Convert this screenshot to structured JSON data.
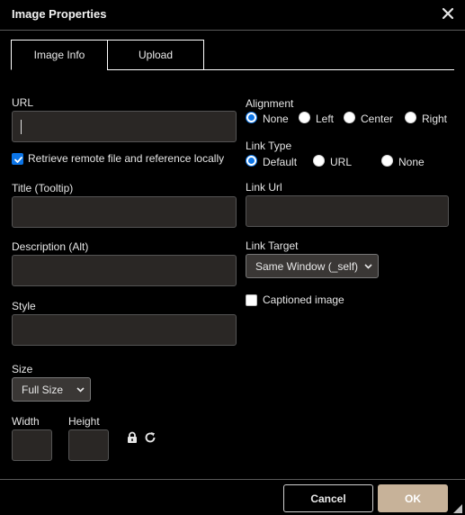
{
  "dialog": {
    "title": "Image Properties"
  },
  "tabs": [
    {
      "label": "Image Info",
      "active": true
    },
    {
      "label": "Upload",
      "active": false
    }
  ],
  "fields": {
    "url_label": "URL",
    "url_value": "",
    "retrieve_label": "Retrieve remote file and reference locally",
    "retrieve_checked": true,
    "title_label": "Title (Tooltip)",
    "title_value": "",
    "description_label": "Description (Alt)",
    "description_value": "",
    "style_label": "Style",
    "style_value": "",
    "size_label": "Size",
    "size_selected": "Full Size",
    "width_label": "Width",
    "width_value": "",
    "height_label": "Height",
    "height_value": ""
  },
  "alignment": {
    "label": "Alignment",
    "options": [
      "None",
      "Left",
      "Center",
      "Right"
    ],
    "selected": "None"
  },
  "link_type": {
    "label": "Link Type",
    "options": [
      "Default",
      "URL",
      "None"
    ],
    "selected": "Default"
  },
  "link_url": {
    "label": "Link Url",
    "value": ""
  },
  "link_target": {
    "label": "Link Target",
    "selected": "Same Window (_self)"
  },
  "captioned": {
    "label": "Captioned image",
    "checked": false
  },
  "buttons": {
    "cancel": "Cancel",
    "ok": "OK"
  },
  "icons": {
    "close": "close-icon",
    "lock": "lock-icon",
    "reset": "refresh-icon",
    "resize": "resize-grip-icon"
  },
  "colors": {
    "accent": "#0b74e6",
    "ok_button": "#c7b299",
    "input_bg": "#2a2725"
  }
}
